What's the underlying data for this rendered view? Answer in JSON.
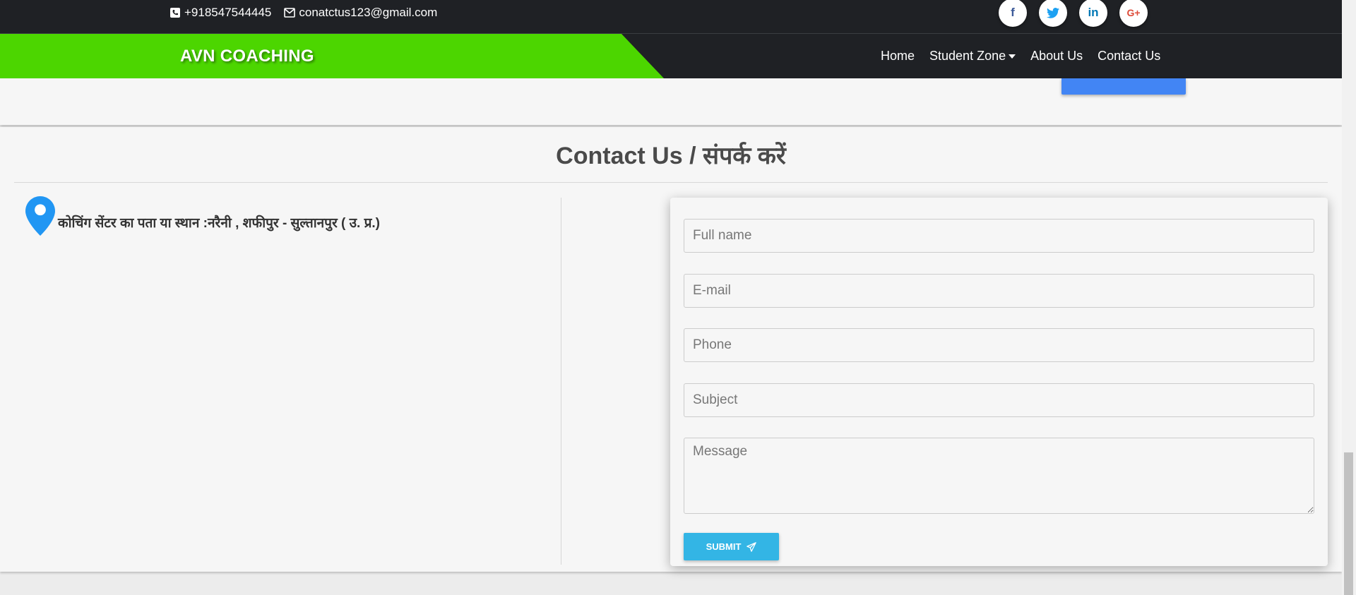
{
  "topbar": {
    "phone": "+918547544445",
    "email": "conatctus123@gmail.com",
    "socials": [
      {
        "icon": "facebook-icon",
        "glyph": "f",
        "color": "#3b5998"
      },
      {
        "icon": "twitter-icon",
        "glyph": "t",
        "color": "#1da1f2"
      },
      {
        "icon": "linkedin-icon",
        "glyph": "in",
        "color": "#0077b5"
      },
      {
        "icon": "google-plus-icon",
        "glyph": "G+",
        "color": "#dd4b39"
      }
    ]
  },
  "navbar": {
    "brand": "AVN COACHING",
    "links": {
      "home": "Home",
      "student_zone": "Student Zone",
      "about": "About Us",
      "contact": "Contact Us"
    }
  },
  "colors": {
    "brand_green": "#4cd600",
    "dark_bar": "#1f2125",
    "accent_blue": "#33b5e5",
    "pin_blue": "#2196f3"
  },
  "contact": {
    "title": "Contact Us / संपर्क करें",
    "address": "कोचिंग सेंटर का पता या स्थान :नरैनी , शफीपुर - सुल्तानपुर ( उ. प्र.)",
    "form": {
      "full_name_placeholder": "Full name",
      "email_placeholder": "E-mail",
      "phone_placeholder": "Phone",
      "subject_placeholder": "Subject",
      "message_placeholder": "Message",
      "submit_label": "SUBMIT"
    }
  }
}
